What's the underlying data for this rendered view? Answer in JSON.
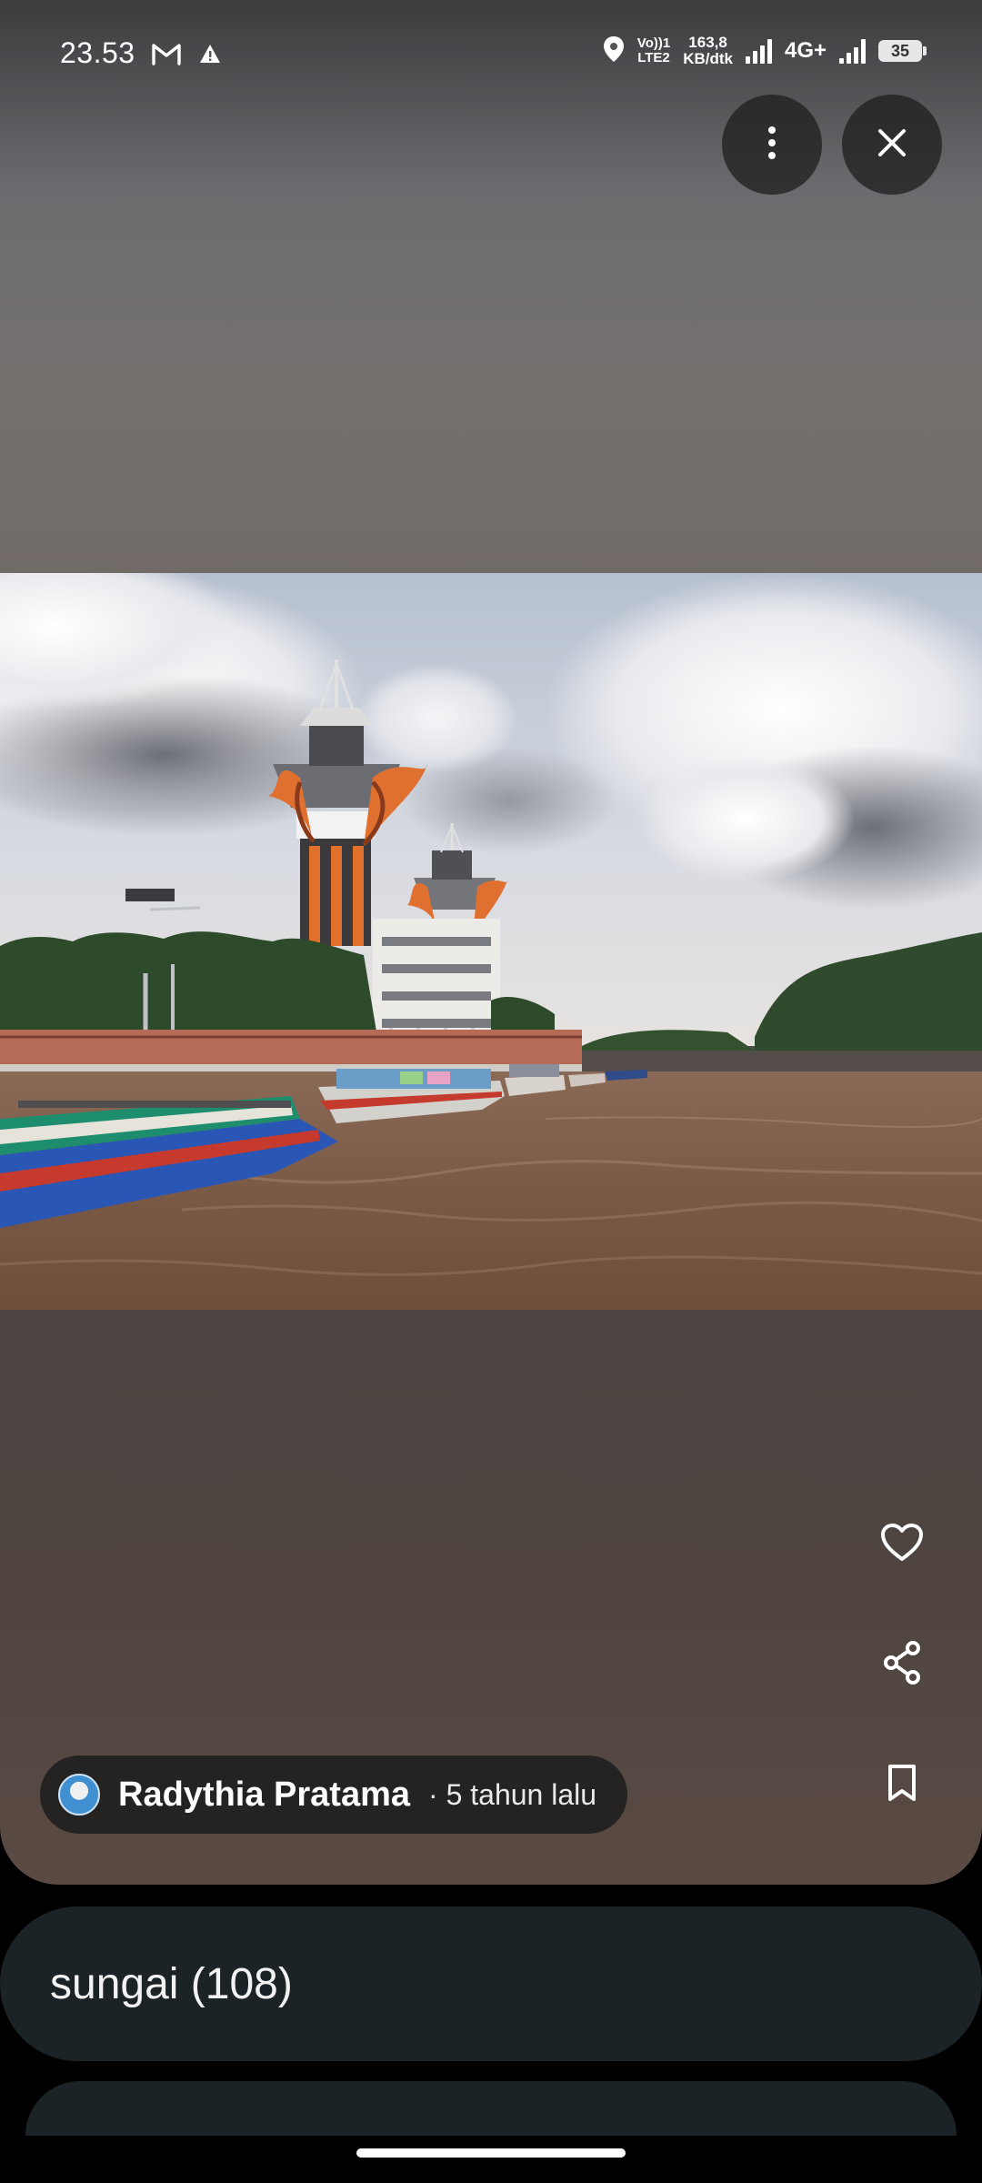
{
  "status_bar": {
    "time": "23.53",
    "volte": "Vo))1",
    "lte": "LTE2",
    "speed_value": "163,8",
    "speed_unit": "KB/dtk",
    "network_type": "4G+",
    "battery": "35"
  },
  "author": {
    "name": "Radythia Pratama",
    "time_ago": "· 5 tahun lalu"
  },
  "tag": {
    "label": "sungai (108)"
  },
  "icons": {
    "more": "more-vert-icon",
    "close": "close-icon",
    "heart": "heart-icon",
    "share": "share-icon",
    "bookmark": "bookmark-icon",
    "gmail": "gmail-icon",
    "alert": "alert-icon",
    "location": "location-icon"
  }
}
